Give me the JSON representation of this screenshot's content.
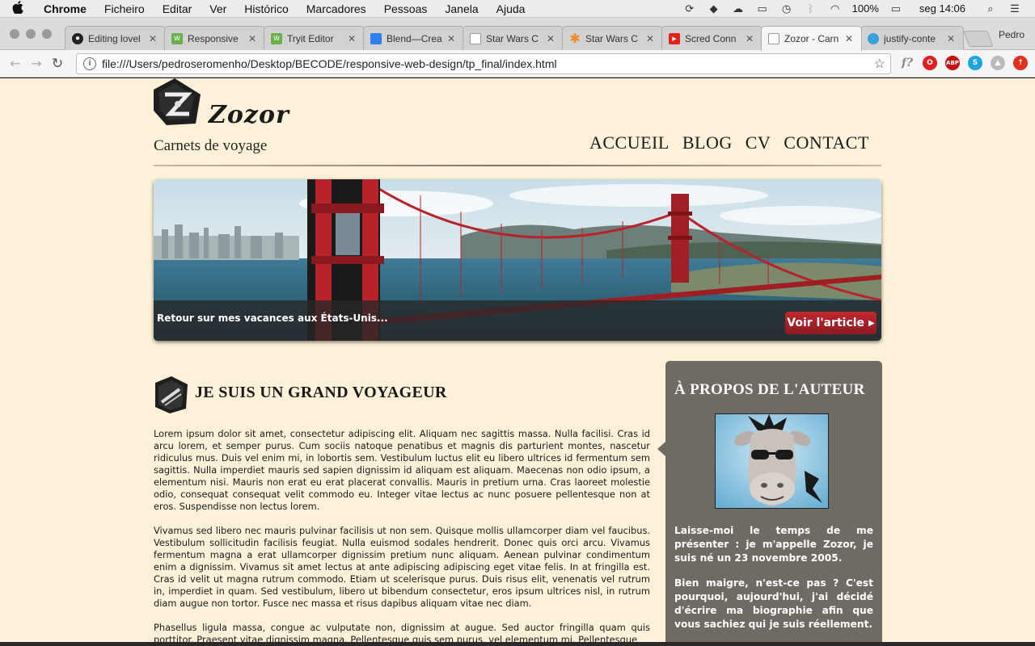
{
  "menubar": {
    "app": "Chrome",
    "items": [
      "Ficheiro",
      "Editar",
      "Ver",
      "Histórico",
      "Marcadores",
      "Pessoas",
      "Janela",
      "Ajuda"
    ],
    "battery": "100%",
    "clock": "seg 14:06"
  },
  "tabs": [
    {
      "title": "Editing lovel",
      "icon": "github-icon",
      "color": "#222222"
    },
    {
      "title": "Responsive",
      "icon": "tryit-icon",
      "color": "#6ab04c"
    },
    {
      "title": "Tryit Editor",
      "icon": "tryit-icon",
      "color": "#6ab04c"
    },
    {
      "title": "Blend—Crea",
      "icon": "blend-icon",
      "color": "#2f80ed"
    },
    {
      "title": "Star Wars C",
      "icon": "page-icon",
      "color": "#ffffff"
    },
    {
      "title": "Star Wars C",
      "icon": "asterisk-icon",
      "color": "#f08a24"
    },
    {
      "title": "Scred Conn",
      "icon": "youtube-icon",
      "color": "#e62117"
    },
    {
      "title": "Zozor - Carn",
      "icon": "page-icon",
      "color": "#ffffff"
    },
    {
      "title": "justify-conte",
      "icon": "css-tricks-icon",
      "color": "#3aa4d8"
    }
  ],
  "profile_name": "Pedro",
  "address": "file:///Users/pedroseromenho/Desktop/BECODE/responsive-web-design/tp_final/index.html",
  "site": {
    "name": "Zozor",
    "tagline": "Carnets de voyage",
    "nav": [
      "ACCUEIL",
      "BLOG",
      "CV",
      "CONTACT"
    ]
  },
  "banner": {
    "caption": "Retour sur mes vacances aux États-Unis...",
    "button": "Voir l'article"
  },
  "article": {
    "title": "JE SUIS UN GRAND VOYAGEUR",
    "paragraphs": [
      "Lorem ipsum dolor sit amet, consectetur adipiscing elit. Aliquam nec sagittis massa. Nulla facilisi. Cras id arcu lorem, et semper purus. Cum sociis natoque penatibus et magnis dis parturient montes, nascetur ridiculus mus. Duis vel enim mi, in lobortis sem. Vestibulum luctus elit eu libero ultrices id fermentum sem sagittis. Nulla imperdiet mauris sed sapien dignissim id aliquam est aliquam. Maecenas non odio ipsum, a elementum nisi. Mauris non erat eu erat placerat convallis. Mauris in pretium urna. Cras laoreet molestie odio, consequat consequat velit commodo eu. Integer vitae lectus ac nunc posuere pellentesque non at eros. Suspendisse non lectus lorem.",
      "Vivamus sed libero nec mauris pulvinar facilisis ut non sem. Quisque mollis ullamcorper diam vel faucibus. Vestibulum sollicitudin facilisis feugiat. Nulla euismod sodales hendrerit. Donec quis orci arcu. Vivamus fermentum magna a erat ullamcorper dignissim pretium nunc aliquam. Aenean pulvinar condimentum enim a dignissim. Vivamus sit amet lectus at ante adipiscing adipiscing eget vitae felis. In at fringilla est. Cras id velit ut magna rutrum commodo. Etiam ut scelerisque purus. Duis risus elit, venenatis vel rutrum in, imperdiet in quam. Sed vestibulum, libero ut bibendum consectetur, eros ipsum ultrices nisl, in rutrum diam augue non tortor. Fusce nec massa et risus dapibus aliquam vitae nec diam.",
      "Phasellus ligula massa, congue ac vulputate non, dignissim at augue. Sed auctor fringilla quam quis porttitor. Praesent vitae dignissim magna. Pellentesque quis sem purus, vel elementum mi. Pellentesque"
    ]
  },
  "aside": {
    "title": "À PROPOS DE L'AUTEUR",
    "paragraphs": [
      "Laisse-moi le temps de me présenter : je m'appelle Zozor, je suis né un 23 novembre 2005.",
      "Bien maigre, n'est-ce pas ? C'est pourquoi, aujourd'hui, j'ai décidé d'écrire ma biographie afin que vous sachiez qui je suis réellement."
    ]
  },
  "colors": {
    "page_bg": "#fdf2d9",
    "aside_bg": "#6f6a64",
    "button_red": "#b0232a"
  }
}
